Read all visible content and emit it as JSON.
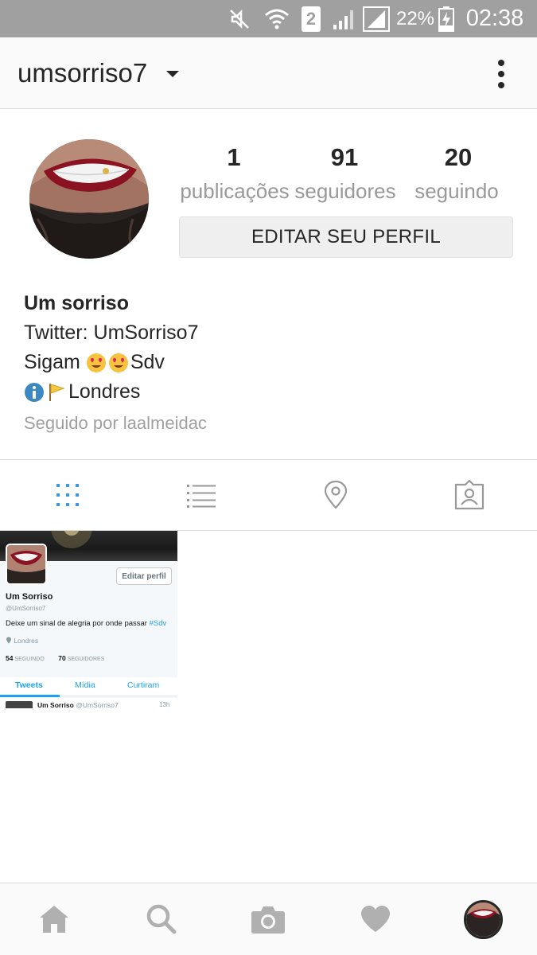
{
  "status_bar": {
    "sim_slot": "2",
    "battery_percent": "22%",
    "time": "02:38",
    "icons": [
      "mute-icon",
      "wifi-icon",
      "sim2-icon",
      "signal-icon",
      "signal-empty-icon",
      "battery-charging-icon"
    ]
  },
  "header": {
    "username": "umsorriso7",
    "dropdown_icon": "caret-down-icon",
    "menu_icon": "more-vertical-icon"
  },
  "profile": {
    "stats": [
      {
        "value": "1",
        "label": "publicações"
      },
      {
        "value": "91",
        "label": "seguidores"
      },
      {
        "value": "20",
        "label": "seguindo"
      }
    ],
    "edit_button": "EDITAR SEU PERFIL",
    "name": "Um sorriso",
    "bio_line1": "Twitter: UmSorriso7",
    "bio_line2_text_before": "Sigam ",
    "bio_line2_text_after": "Sdv",
    "bio_line3_text": "Londres",
    "followed_by": "Seguido por laalmeidac"
  },
  "tabs": [
    {
      "name": "grid",
      "icon": "grid-icon",
      "active": true
    },
    {
      "name": "list",
      "icon": "list-icon",
      "active": false
    },
    {
      "name": "map",
      "icon": "location-pin-icon",
      "active": false
    },
    {
      "name": "tagged",
      "icon": "tagged-person-icon",
      "active": false
    }
  ],
  "post": {
    "edit_profile": "Editar perfil",
    "name": "Um Sorriso",
    "handle": "@UmSorriso7",
    "description": "Deixe um sinal de alegria por onde passar ",
    "hashtag": "#Sdv",
    "location": "Londres",
    "following_count": "54",
    "following_label": "SEGUINDO",
    "followers_count": "70",
    "followers_label": "SEGUIDORES",
    "tabs": [
      "Tweets",
      "Mídia",
      "Curtiram"
    ],
    "tweet_name": "Um Sorriso",
    "tweet_handle": "@UmSorriso7",
    "tweet_time": "13h"
  },
  "bottom_nav": [
    {
      "name": "home",
      "icon": "home-icon"
    },
    {
      "name": "search",
      "icon": "search-icon"
    },
    {
      "name": "camera",
      "icon": "camera-icon"
    },
    {
      "name": "activity",
      "icon": "heart-icon"
    },
    {
      "name": "profile",
      "icon": "profile-avatar"
    }
  ],
  "colors": {
    "status_bar": "#a0a0a0",
    "active_tab": "#3897f0",
    "inactive_icon": "#999999",
    "twitter_blue": "#1da1f2"
  }
}
